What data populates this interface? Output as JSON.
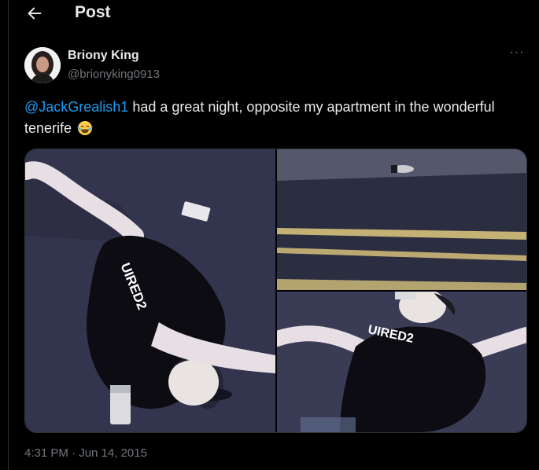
{
  "header": {
    "title": "Post",
    "back_icon": "arrow-left-icon"
  },
  "author": {
    "name": "Briony King",
    "handle": "@brionyking0913",
    "more_icon": "more-dots-icon"
  },
  "tweet": {
    "mention": "@JackGrealish1",
    "text": " had a great night, opposite my apartment in the wonderful tenerife",
    "emoji": "face-with-tears-of-joy"
  },
  "media": {
    "count": 3,
    "shirt_text": "UIRED2"
  },
  "timestamp": "4:31 PM · Jun 14, 2015",
  "colors": {
    "background": "#000000",
    "link": "#1d9bf0",
    "muted": "#71767b",
    "text": "#e7e9ea"
  }
}
